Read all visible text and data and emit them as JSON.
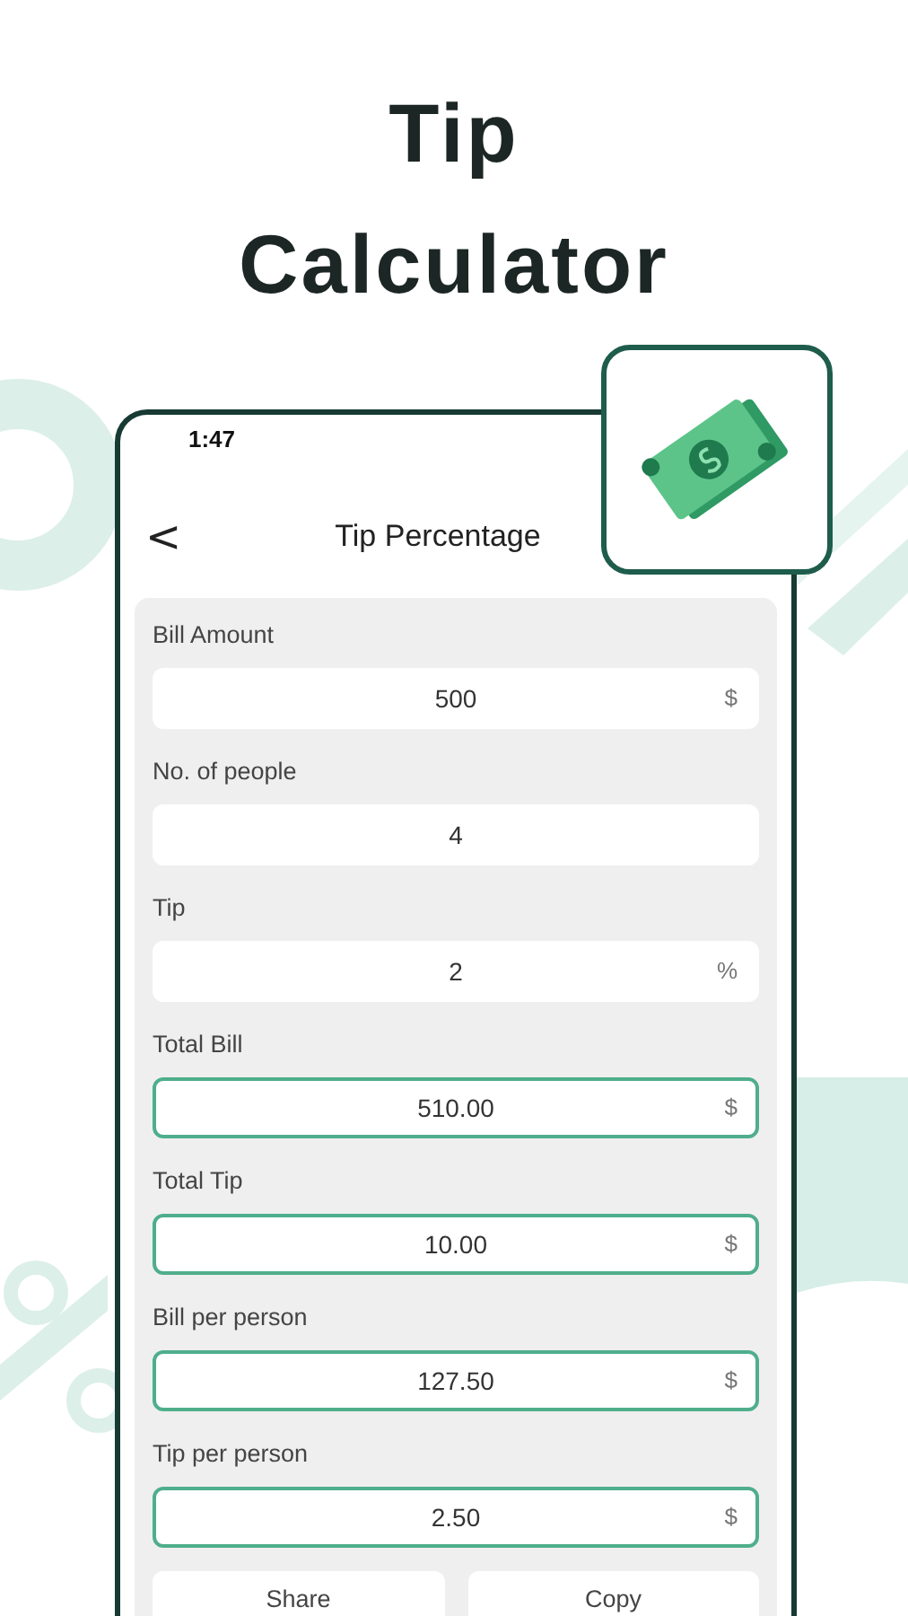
{
  "headline": "Tip Calculator",
  "status_bar": {
    "time": "1:47"
  },
  "header": {
    "back": "<",
    "title": "Tip Percentage"
  },
  "fields": [
    {
      "label": "Bill Amount",
      "value": "500",
      "unit": "$",
      "kind": "input"
    },
    {
      "label": "No. of people",
      "value": "4",
      "kind": "input"
    },
    {
      "label": "Tip",
      "value": "2",
      "unit": "%",
      "kind": "input"
    },
    {
      "label": "Total Bill",
      "value": "510.00",
      "unit": "$",
      "kind": "result"
    },
    {
      "label": "Total Tip",
      "value": "10.00",
      "unit": "$",
      "kind": "result"
    },
    {
      "label": "Bill per person",
      "value": "127.50",
      "unit": "$",
      "kind": "result"
    },
    {
      "label": "Tip per person",
      "value": "2.50",
      "unit": "$",
      "kind": "result"
    }
  ],
  "buttons": [
    "Share",
    "Copy"
  ]
}
